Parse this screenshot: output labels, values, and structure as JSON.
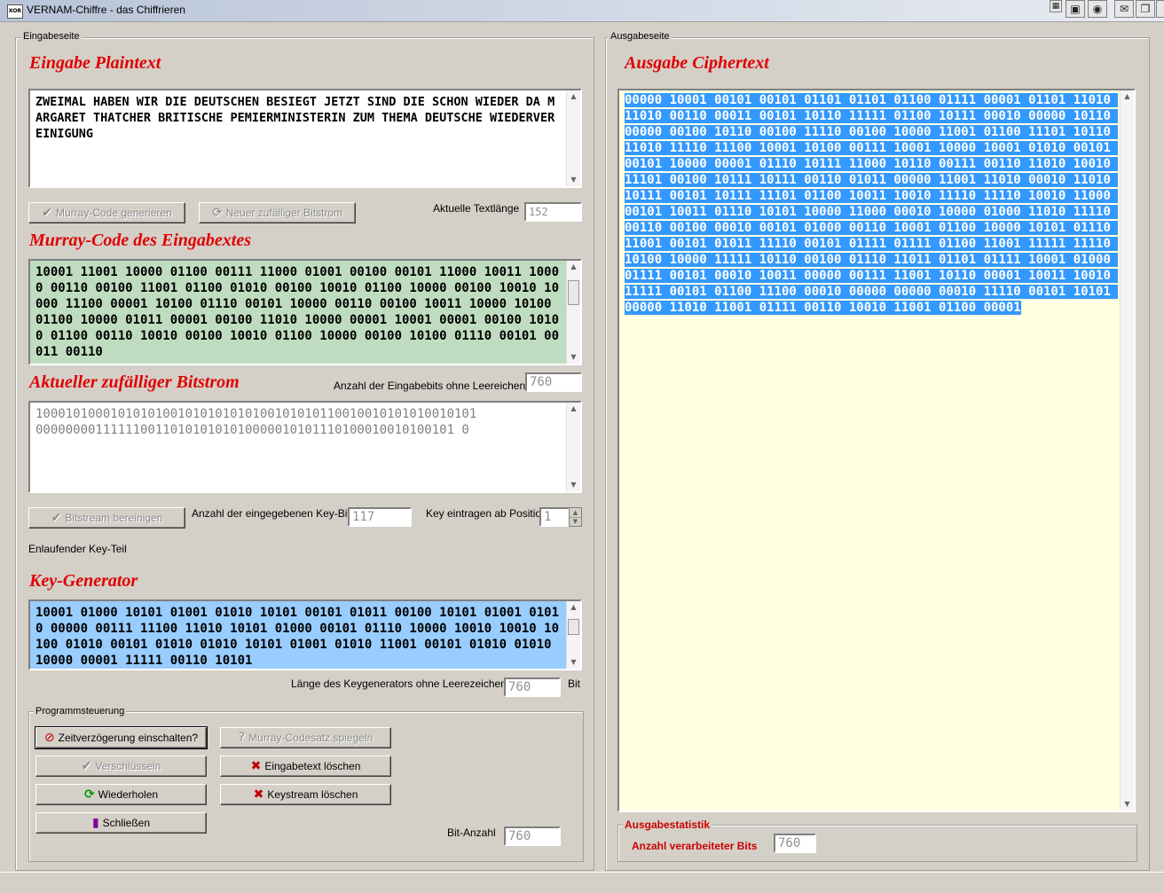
{
  "window": {
    "title": "VERNAM-Chiffre - das Chiffrieren",
    "icon_text": "XOR"
  },
  "input_side": {
    "group_label": "Eingabeseite",
    "plaintext": {
      "heading": "Eingabe Plaintext",
      "text": "ZWEIMAL HABEN WIR DIE DEUTSCHEN BESIEGT JETZT SIND DIE SCHON WIEDER DA MARGARET THATCHER BRITISCHE PEMIERMINISTERIN ZUM THEMA DEUTSCHE WIEDERVEREINIGUNG"
    },
    "buttons_row1": {
      "murray_generate": "Murray-Code generieren",
      "new_bitstream": "Neuer zufälliger Bitstrom"
    },
    "text_length": {
      "label": "Aktuelle Textlänge",
      "value": "152"
    },
    "murray": {
      "heading": "Murray-Code des Eingabextes",
      "text": "10001 11001 10000 01100 00111 11000 01001 00100 00101 11000 10011 10000 00110 00100 11001 01100 01010 00100 10010 01100 10000 00100 10010 10000 11100 00001 10100 01110 00101 10000 00110 00100 10011 10000 10100 01100 10000 01011 00001 00100 11010 10000 00001 10001 00001 00100 10100 01100 00110 10010 00100 10010 01100 10000 00100 10100 01110 00101 00011 00110"
    },
    "bitstream": {
      "heading": "Aktueller zufälliger Bitstrom",
      "count_label": "Anzahl der Eingabebits ohne Leereichen",
      "count_value": "760",
      "text": "10001010001010101001010101010100101010110010010101010010101\n00000000111111001101010101010000010101110100010010100101 0"
    },
    "bitstream_controls": {
      "clean_button": "Bitstream bereinigen",
      "keybits_label": "Anzahl der eingegebenen Key-Bits",
      "keybits_value": "117",
      "position_label": "Key eintragen ab Position",
      "position_value": "1",
      "incoming_label": "Enlaufender Key-Teil"
    },
    "keygen": {
      "heading": "Key-Generator",
      "text": "10001 01000 10101 01001 01010 10101 00101 01011 00100 10101 01001 01010 00000 00111 11100 11010 10101 01000 00101 01110 10000 10010 10010 10100 01010 00101 01010 01010 10101 01001 01010 11001 00101 01010 01010 10000 00001 11111 00110 10101",
      "length_label": "Länge des Keygenerators ohne Leerezeichen",
      "length_value": "760",
      "length_unit": "Bit"
    },
    "program_control": {
      "group_label": "Programmsteuerung",
      "delay": "Zeitverzögerung einschalten?",
      "mirror": "Murray-Codesatz spiegeln",
      "encrypt": "Verschlüsseln",
      "clear_input": "Eingabetext löschen",
      "repeat": "Wiederholen",
      "clear_keystream": "Keystream löschen",
      "close": "Schließen",
      "bitcount_label": "Bit-Anzahl",
      "bitcount_value": "760"
    }
  },
  "output_side": {
    "group_label": "Ausgabeseite",
    "heading": "Ausgabe Ciphertext",
    "text": "00000 10001 00101 00101 01101 01101 01100 01111 00001 01101 11010 11010 00110 00011 00101 10110 11111 01100 10111 00010 00000 10110 00000 00100 10110 00100 11110 00100 10000 11001 01100 11101 10110 11010 11110 11100 10001 10100 00111 10001 10000 10001 01010 00101 00101 10000 00001 01110 10111 11000 10110 00111 00110 11010 10010 11101 00100 10111 10111 00110 01011 00000 11001 11010 00010 11010 10111 00101 10111 11101 01100 10011 10010 11110 11110 10010 11000 00101 10011 01110 10101 10000 11000 00010 10000 01000 11010 11110 00110 00100 00010 00101 01000 00110 10001 01100 10000 10101 01110 11001 00101 01011 11110 00101 01111 01111 01100 11001 11111 11110 10100 10000 11111 10110 00100 01110 11011 01101 01111 10001 01000 01111 00101 00010 10011 00000 00111 11001 10110 00001 10011 10010 11111 00101 01100 11100 00010 00000 00000 00010 11110 00101 10101 00000 11010 11001 01111 00110 10010 11001 01100 00001",
    "stats": {
      "group_label": "Ausgabestatistik",
      "processed_label": "Anzahl verarbeiteter Bits",
      "processed_value": "760"
    }
  },
  "colors": {
    "heading_red": "#e00000",
    "murray_bg": "#c0dcc0",
    "selection_blue": "#3399ff",
    "output_bg": "#ffffe1"
  }
}
